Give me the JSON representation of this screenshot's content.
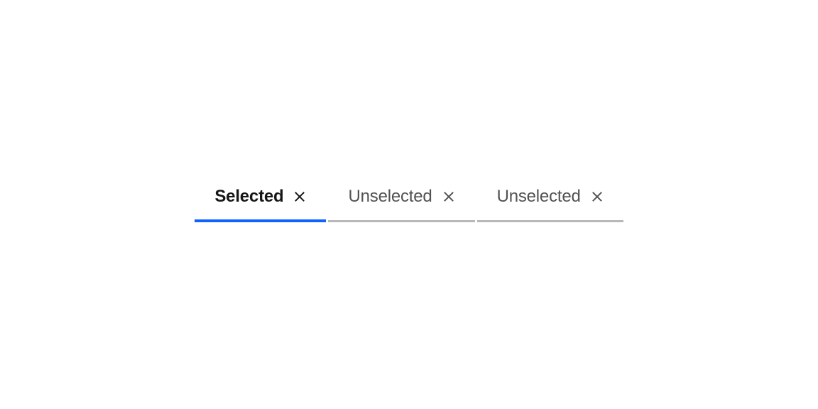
{
  "tabs": [
    {
      "label": "Selected",
      "state": "selected",
      "closable": true
    },
    {
      "label": "Unselected",
      "state": "unselected",
      "closable": true
    },
    {
      "label": "Unselected",
      "state": "unselected",
      "closable": true
    }
  ],
  "colors": {
    "accent": "#0f62fe",
    "border_inactive": "#b8b8b8",
    "text_active": "#161616",
    "text_inactive": "#525252"
  }
}
